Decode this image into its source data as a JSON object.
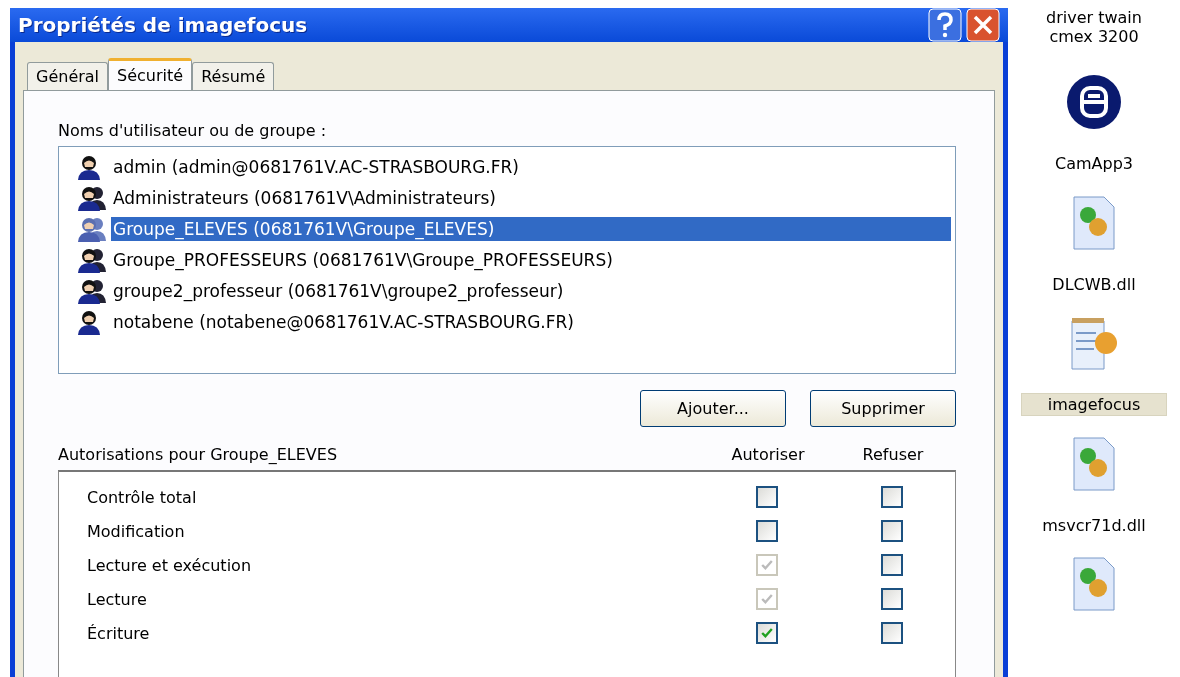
{
  "window": {
    "title": "Propriétés de imagefocus"
  },
  "tabs": [
    {
      "label": "Général",
      "selected": false
    },
    {
      "label": "Sécurité",
      "selected": true
    },
    {
      "label": "Résumé",
      "selected": false
    }
  ],
  "users_label": "Noms d'utilisateur ou de groupe :",
  "users": [
    {
      "kind": "user",
      "name": "admin (admin@0681761V.AC-STRASBOURG.FR)",
      "selected": false
    },
    {
      "kind": "group",
      "name": "Administrateurs (0681761V\\Administrateurs)",
      "selected": false
    },
    {
      "kind": "group",
      "name": "Groupe_ELEVES (0681761V\\Groupe_ELEVES)",
      "selected": true
    },
    {
      "kind": "group",
      "name": "Groupe_PROFESSEURS (0681761V\\Groupe_PROFESSEURS)",
      "selected": false
    },
    {
      "kind": "group",
      "name": "groupe2_professeur (0681761V\\groupe2_professeur)",
      "selected": false
    },
    {
      "kind": "user",
      "name": "notabene (notabene@0681761V.AC-STRASBOURG.FR)",
      "selected": false
    }
  ],
  "buttons": [
    "Ajouter...",
    "Supprimer"
  ],
  "permissions_label": "Autorisations pour Groupe_ELEVES",
  "permission_columns": [
    "Autoriser",
    "Refuser"
  ],
  "permissions": [
    {
      "name": "Contrôle total",
      "allow": {
        "checked": false,
        "disabled": false
      },
      "deny": {
        "checked": false,
        "disabled": false
      }
    },
    {
      "name": "Modification",
      "allow": {
        "checked": false,
        "disabled": false
      },
      "deny": {
        "checked": false,
        "disabled": false
      }
    },
    {
      "name": "Lecture et exécution",
      "allow": {
        "checked": true,
        "disabled": true
      },
      "deny": {
        "checked": false,
        "disabled": false
      }
    },
    {
      "name": "Lecture",
      "allow": {
        "checked": true,
        "disabled": true
      },
      "deny": {
        "checked": false,
        "disabled": false
      }
    },
    {
      "name": "Écriture",
      "allow": {
        "checked": true,
        "disabled": false
      },
      "deny": {
        "checked": false,
        "disabled": false
      }
    }
  ],
  "desktop_icons": [
    {
      "kind": "none",
      "label": "driver twain cmex 3200",
      "selected": false
    },
    {
      "kind": "app",
      "label": "CamApp3",
      "selected": false
    },
    {
      "kind": "dll",
      "label": "DLCWB.dll",
      "selected": false
    },
    {
      "kind": "config",
      "label": "imagefocus",
      "selected": true
    },
    {
      "kind": "dll",
      "label": "msvcr71d.dll",
      "selected": false
    },
    {
      "kind": "dll"
    }
  ]
}
